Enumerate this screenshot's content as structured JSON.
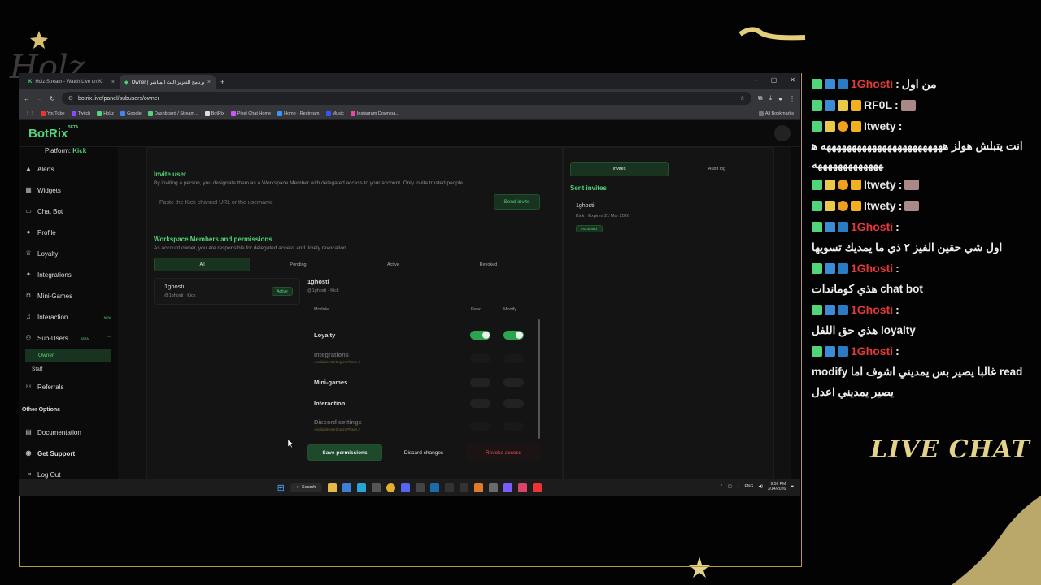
{
  "browser": {
    "tabs": [
      {
        "label": "Holz Stream - Watch Live on Ki"
      },
      {
        "label": "Owner | برنامج التعزيز البث المباشر"
      }
    ],
    "url": "botrix.live/panel/subusers/owner",
    "bookmarks": [
      "YouTube",
      "Twitch",
      "HoLz",
      "Google",
      "Dashboard / Stream...",
      "BotRix",
      "Pixel Chat Home",
      "Home - Restream",
      "Music",
      "Instagram Downloa..."
    ],
    "all_bookmarks": "All Bookmarks"
  },
  "app": {
    "brand": "BotRix",
    "brand_badge": "BETA",
    "platform_label": "Platform:",
    "platform_value": "Kick",
    "sidebar": {
      "items": [
        {
          "label": "Alerts",
          "icon": "triangle-alert-icon"
        },
        {
          "label": "Widgets",
          "icon": "grid-icon"
        },
        {
          "label": "Chat Bot",
          "icon": "chat-icon"
        },
        {
          "label": "Profile",
          "icon": "user-icon"
        },
        {
          "label": "Loyalty",
          "icon": "trophy-icon"
        },
        {
          "label": "Integrations",
          "icon": "puzzle-icon"
        },
        {
          "label": "Mini-Games",
          "icon": "gamepad-icon"
        },
        {
          "label": "Interaction",
          "icon": "music-icon",
          "badge": "NEW"
        },
        {
          "label": "Sub-Users",
          "icon": "users-icon",
          "badge": "BETA"
        }
      ],
      "subitems": [
        "Owner",
        "Staff"
      ],
      "referrals": "Referrals",
      "other_heading": "Other Options",
      "other": [
        "Documentation",
        "Get Support",
        "Log Out"
      ]
    },
    "invite": {
      "title": "Invite user",
      "description": "By inviting a person, you designate them as a Workspace Member with delegated access to your account. Only invite trusted people.",
      "placeholder": "Paste the Kick channel URL or the username",
      "send_label": "Send invite"
    },
    "members": {
      "title": "Workspace Members and permissions",
      "description": "As account owner, you are responsible for delegated access and timely revocation.",
      "tabs": [
        "All",
        "Pending",
        "Active",
        "Revoked"
      ],
      "member": {
        "name": "1ghosti",
        "sub": "@1ghosti · Kick",
        "status": "Active"
      },
      "detail": {
        "name": "1ghosti",
        "sub": "@1ghosti · Kick"
      },
      "columns": {
        "module": "Module",
        "read": "Read",
        "modify": "Modify"
      },
      "modules": [
        {
          "name": "Loyalty",
          "note": "",
          "read": true,
          "modify": true,
          "enabled": true
        },
        {
          "name": "Integrations",
          "note": "Available starting in Phase 2",
          "read": false,
          "modify": false,
          "enabled": false
        },
        {
          "name": "Mini-games",
          "note": "",
          "read": false,
          "modify": false,
          "enabled": true
        },
        {
          "name": "Interaction",
          "note": "",
          "read": false,
          "modify": false,
          "enabled": true
        },
        {
          "name": "Discord settings",
          "note": "Available starting in Phase 2",
          "read": false,
          "modify": false,
          "enabled": false
        }
      ],
      "save_label": "Save permissions",
      "discard_label": "Discard changes",
      "revoke_label": "Revoke access"
    },
    "invites_panel": {
      "tabs": [
        "Invites",
        "Audit log"
      ],
      "heading": "Sent invites",
      "item": {
        "name": "1ghosti",
        "sub": "Kick · Expires 21 Mar 2026",
        "status": "Accepted"
      }
    },
    "taskbar": {
      "search": "Search",
      "lang": "ENG",
      "time": "9:50 PM",
      "date": "3/14/2026"
    }
  },
  "chat": {
    "messages": [
      {
        "user": "1Ghosti",
        "text": "من اول"
      },
      {
        "user": "RF0L",
        "text": ""
      },
      {
        "user": "Itwety",
        "text": "انت يتبلش هولز ههههههههههههههههههههههههه ههههههههههههههه"
      },
      {
        "user": "Itwety",
        "text": ""
      },
      {
        "user": "Itwety",
        "text": ""
      },
      {
        "user": "1Ghosti",
        "text": "اول شي حقين الفيز ٢ ذي ما يمديك تسويها"
      },
      {
        "user": "1Ghosti",
        "text": "chat bot هذي كوماندات"
      },
      {
        "user": "1Ghosti",
        "text": "loyalty هذي حق اللفل"
      },
      {
        "user": "1Ghosti",
        "text": "read غالبا يصير بس يمديني اشوف اما modify يصير يمديني اعدل"
      }
    ],
    "title": "LIVE CHAT"
  },
  "colors": {
    "accent": "#52d47a",
    "gold": "#e3d289",
    "name_red": "#e03a3a"
  }
}
